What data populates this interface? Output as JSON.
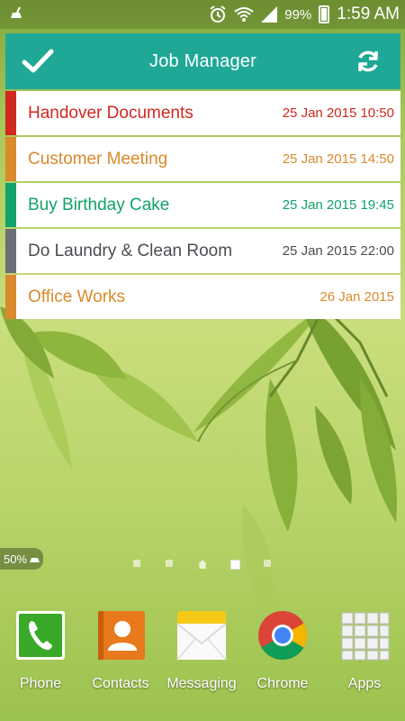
{
  "status_bar": {
    "battery_percent": "99%",
    "time": "1:59 AM"
  },
  "widget": {
    "title": "Job Manager",
    "jobs": [
      {
        "title": "Handover Documents",
        "date": "25 Jan 2015 10:50",
        "color": "#d0281f"
      },
      {
        "title": "Customer Meeting",
        "date": "25 Jan 2015 14:50",
        "color": "#d98a2c"
      },
      {
        "title": "Buy Birthday Cake",
        "date": "25 Jan 2015 19:45",
        "color": "#12a26a"
      },
      {
        "title": "Do Laundry & Clean Room",
        "date": "25 Jan 2015 22:00",
        "color": "#6b6f75"
      },
      {
        "title": "Office Works",
        "date": "26 Jan 2015",
        "color": "#d98a2c"
      }
    ]
  },
  "battery_badge": "50%",
  "dock": [
    {
      "label": "Phone",
      "icon": "phone-icon"
    },
    {
      "label": "Contacts",
      "icon": "contacts-icon"
    },
    {
      "label": "Messaging",
      "icon": "messaging-icon"
    },
    {
      "label": "Chrome",
      "icon": "chrome-icon"
    },
    {
      "label": "Apps",
      "icon": "apps-grid-icon"
    }
  ],
  "colors": {
    "header": "#1fa896",
    "title_text": "#ffffff"
  }
}
